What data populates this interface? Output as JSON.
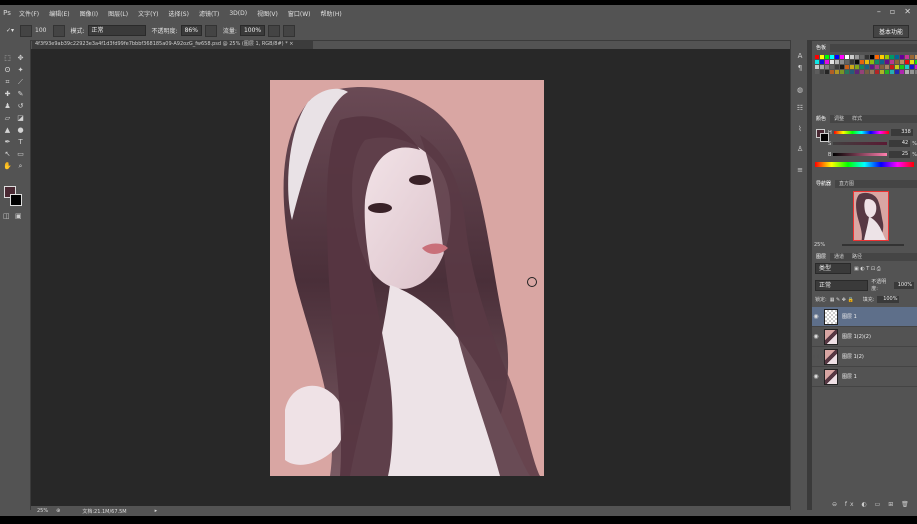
{
  "app": {
    "logo": "Ps"
  },
  "menu": [
    "文件(F)",
    "编辑(E)",
    "图像(I)",
    "图层(L)",
    "文字(Y)",
    "选择(S)",
    "滤镜(T)",
    "3D(D)",
    "视图(V)",
    "窗口(W)",
    "帮助(H)"
  ],
  "window_controls": {
    "minimize": "–",
    "restore": "▫",
    "close": "✕"
  },
  "options": {
    "brush_size": "100",
    "mode_label": "模式:",
    "mode_value": "正常",
    "opacity_label": "不透明度:",
    "opacity_value": "86%",
    "flow_label": "流量:",
    "flow_value": "100%"
  },
  "workspace": "基本功能",
  "document": {
    "tab_title": "4f3f93e9ab39c22923e3a4f1d3fd99fe7bbbf368185a09-A92ozG_fw658.psd @ 25% (图层 1, RGB/8#) *  ×"
  },
  "status": {
    "zoom": "25%",
    "doc_info": "文档:21.1M/67.5M"
  },
  "swatches_panel": {
    "title": "色板"
  },
  "color_panel": {
    "tabs": [
      "颜色",
      "调整",
      "样式"
    ],
    "h_label": "H",
    "h_value": "338",
    "s_label": "S",
    "s_value": "42",
    "b_label": "B",
    "b_value": "25",
    "unit": "%",
    "colors": {
      "foreground": "#4a2933",
      "background": "#000000"
    }
  },
  "navigator_panel": {
    "tabs": [
      "导航器",
      "直方图"
    ],
    "zoom": "25%"
  },
  "layers_panel": {
    "tabs": [
      "图层",
      "通道",
      "路径"
    ],
    "filter_label": "类型",
    "blend_mode": "正常",
    "opacity_label": "不透明度:",
    "opacity_value": "100%",
    "lock_label": "锁定:",
    "fill_label": "填充:",
    "fill_value": "100%",
    "layers": [
      {
        "name": "图层 1",
        "selected": true,
        "visible": true
      },
      {
        "name": "图层 1(2)(2)",
        "selected": false,
        "visible": true
      },
      {
        "name": "图层 1(2)",
        "selected": false,
        "visible": false
      },
      {
        "name": "图层 1",
        "selected": false,
        "visible": true
      }
    ]
  },
  "accent_colors": {
    "canvas_bg": "#d9a6a3",
    "workspace": "#282828",
    "selection": "#5e6f8a"
  }
}
